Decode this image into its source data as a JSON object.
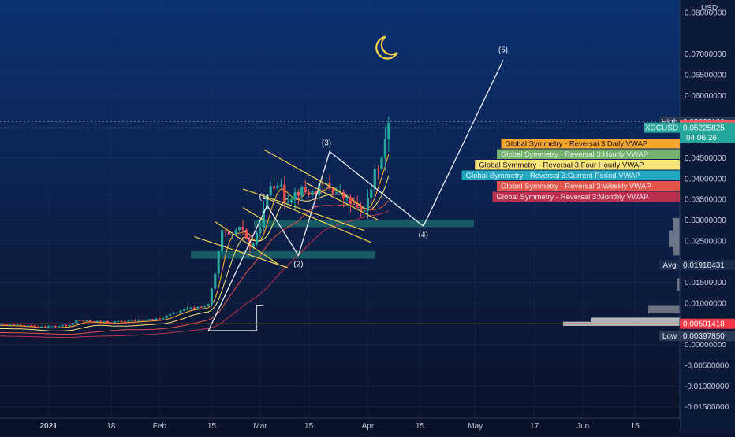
{
  "chart_data": {
    "type": "candlestick",
    "symbol": "XDCUSD",
    "currency": "USD",
    "ylim": [
      -0.016,
      0.0815
    ],
    "x_ticks": [
      "2021",
      "18",
      "Feb",
      "15",
      "Mar",
      "15",
      "Apr",
      "15",
      "May",
      "17",
      "Jun",
      "15"
    ],
    "y_ticks": [
      "0.08000000",
      "0.07000000",
      "0.06500000",
      "0.06000000",
      "0.04500000",
      "0.04000000",
      "0.03500000",
      "0.03000000",
      "0.02500000",
      "0.01500000",
      "0.01000000",
      "0.00500000",
      "0.00000000",
      "-0.00500000",
      "-0.01000000",
      "-0.01500000"
    ],
    "y_tick_values": [
      0.08,
      0.07,
      0.065,
      0.06,
      0.045,
      0.04,
      0.035,
      0.03,
      0.025,
      0.015,
      0.01,
      0.005,
      0.0,
      -0.005,
      -0.01,
      -0.015
    ],
    "price_labels": {
      "high_label": "High",
      "high_value": "0.05369100",
      "high_price": 0.053691,
      "marker_value": "0.05369100",
      "marker_price": 0.0529,
      "last_symbol": "XDCUSD",
      "last_value": "0.05225825",
      "last_price": 0.05225825,
      "countdown": "04:06:26",
      "avg_label": "Avg",
      "avg_value": "0.01918431",
      "avg_price": 0.01918431,
      "line_value": "0.00501418",
      "line_price": 0.00501418,
      "low_label": "Low",
      "low_value": "0.00397850",
      "low_price": 0.0039785
    },
    "vwap_legend": [
      {
        "label": "Global Symmetry - Reversal 3:Daily VWAP",
        "bg": "#f7a531",
        "fg": "#111111"
      },
      {
        "label": "Global Symmetry - Reversal 3:Hourly VWAP",
        "bg": "#74b06e",
        "fg": "#e8f2e6"
      },
      {
        "label": "Global Symmetry - Reversal 3:Four Hourly VWAP",
        "bg": "#fce57a",
        "fg": "#111111"
      },
      {
        "label": "Global Symmetry - Reversal 3:Current Period VWAP",
        "bg": "#21a7c0",
        "fg": "#e4f6fa"
      },
      {
        "label": "Global Symmetry - Reversal 3:Weekly VWAP",
        "bg": "#e4544d",
        "fg": "#fdecea"
      },
      {
        "label": "Global Symmetry - Reversal 3:Monthly VWAP",
        "bg": "#b8324f",
        "fg": "#fbe5ea"
      }
    ],
    "wave_labels": [
      "(1)",
      "(2)",
      "(3)",
      "(4)",
      "(5)"
    ],
    "wave_points": [
      {
        "label": "",
        "x": 60,
        "y": 0.0032
      },
      {
        "label": "(1)",
        "x": 77,
        "y": 0.0335
      },
      {
        "label": "(2)",
        "x": 86,
        "y": 0.0215
      },
      {
        "label": "(3)",
        "x": 95,
        "y": 0.0465
      },
      {
        "label": "(4)",
        "x": 122,
        "y": 0.0285
      },
      {
        "label": "(5)",
        "x": 145,
        "y": 0.0685
      }
    ],
    "colors": {
      "up": "#26a69a",
      "down": "#ef5350",
      "moon": "#f6d44a",
      "channel": "#f3cf55",
      "wave": "#e8ecf4",
      "zone": "#1c6e6e",
      "volume_profile": "#c9c9c9",
      "price_line": "#f23645"
    }
  }
}
